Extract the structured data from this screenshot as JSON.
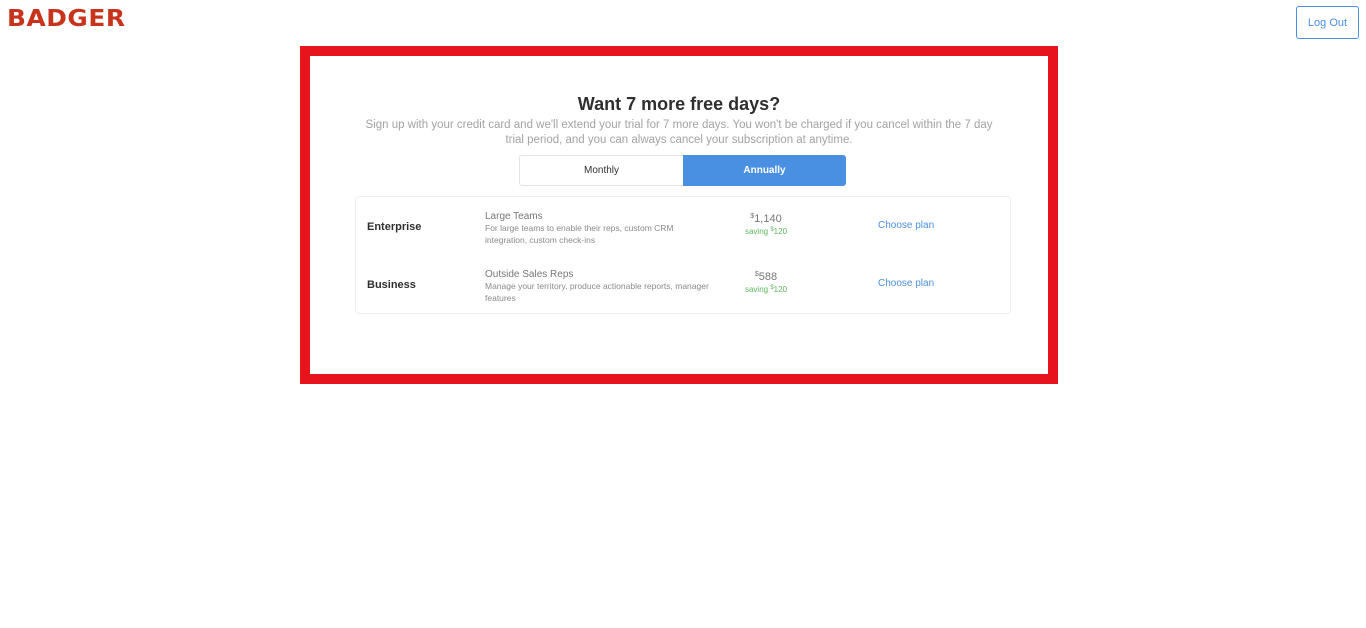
{
  "header": {
    "logo_text": "BADGER",
    "logout_label": "Log Out"
  },
  "colors": {
    "brand": "#c8331c",
    "accent": "#4a90e2",
    "saving": "#5cb85c",
    "highlight_frame": "#e8141c"
  },
  "modal": {
    "title": "Want 7 more free days?",
    "subtitle": "Sign up with your credit card and we'll extend your trial for 7 more days. You won't be charged if you cancel within the 7 day trial period, and you can always cancel your subscription at anytime.",
    "toggle": {
      "options": [
        "Monthly",
        "Annually"
      ],
      "selected": "Annually"
    },
    "plans": [
      {
        "name": "Enterprise",
        "tagline": "Large Teams",
        "description": "For large teams to enable their reps, custom CRM integration, custom check-ins",
        "currency": "$",
        "price": "1,140",
        "saving_prefix": "saving",
        "saving_amount": "120",
        "cta": "Choose plan"
      },
      {
        "name": "Business",
        "tagline": "Outside Sales Reps",
        "description": "Manage your territory, produce actionable reports, manager features",
        "currency": "$",
        "price": "588",
        "saving_prefix": "saving",
        "saving_amount": "120",
        "cta": "Choose plan"
      }
    ]
  }
}
